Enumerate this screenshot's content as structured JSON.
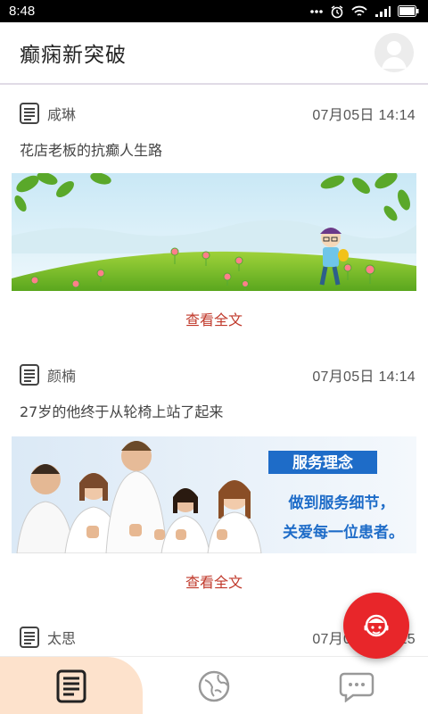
{
  "status_bar": {
    "time": "8:48"
  },
  "header": {
    "title": "癫痫新突破"
  },
  "articles": [
    {
      "author": "咸琳",
      "date": "07月05日 14:14",
      "title": "花店老板的抗癫人生路",
      "link_label": "查看全文",
      "image": "cartoon-hillside-banner"
    },
    {
      "author": "颜楠",
      "date": "07月05日 14:14",
      "title": "27岁的他终于从轮椅上站了起来",
      "link_label": "查看全文",
      "image": "medical-staff-banner",
      "banner": {
        "heading": "服务理念",
        "line1": "做到服务细节，",
        "line2": "关爱每一位患者。"
      }
    },
    {
      "author": "太思",
      "date": "07月05日 14:15"
    }
  ],
  "bottom_nav": {
    "items": [
      "articles-icon",
      "globe-icon",
      "chat-icon"
    ],
    "active": 0
  },
  "colors": {
    "accent_red": "#e8262a",
    "link_red": "#c0392b",
    "nav_active_bg": "#fde2cc"
  }
}
